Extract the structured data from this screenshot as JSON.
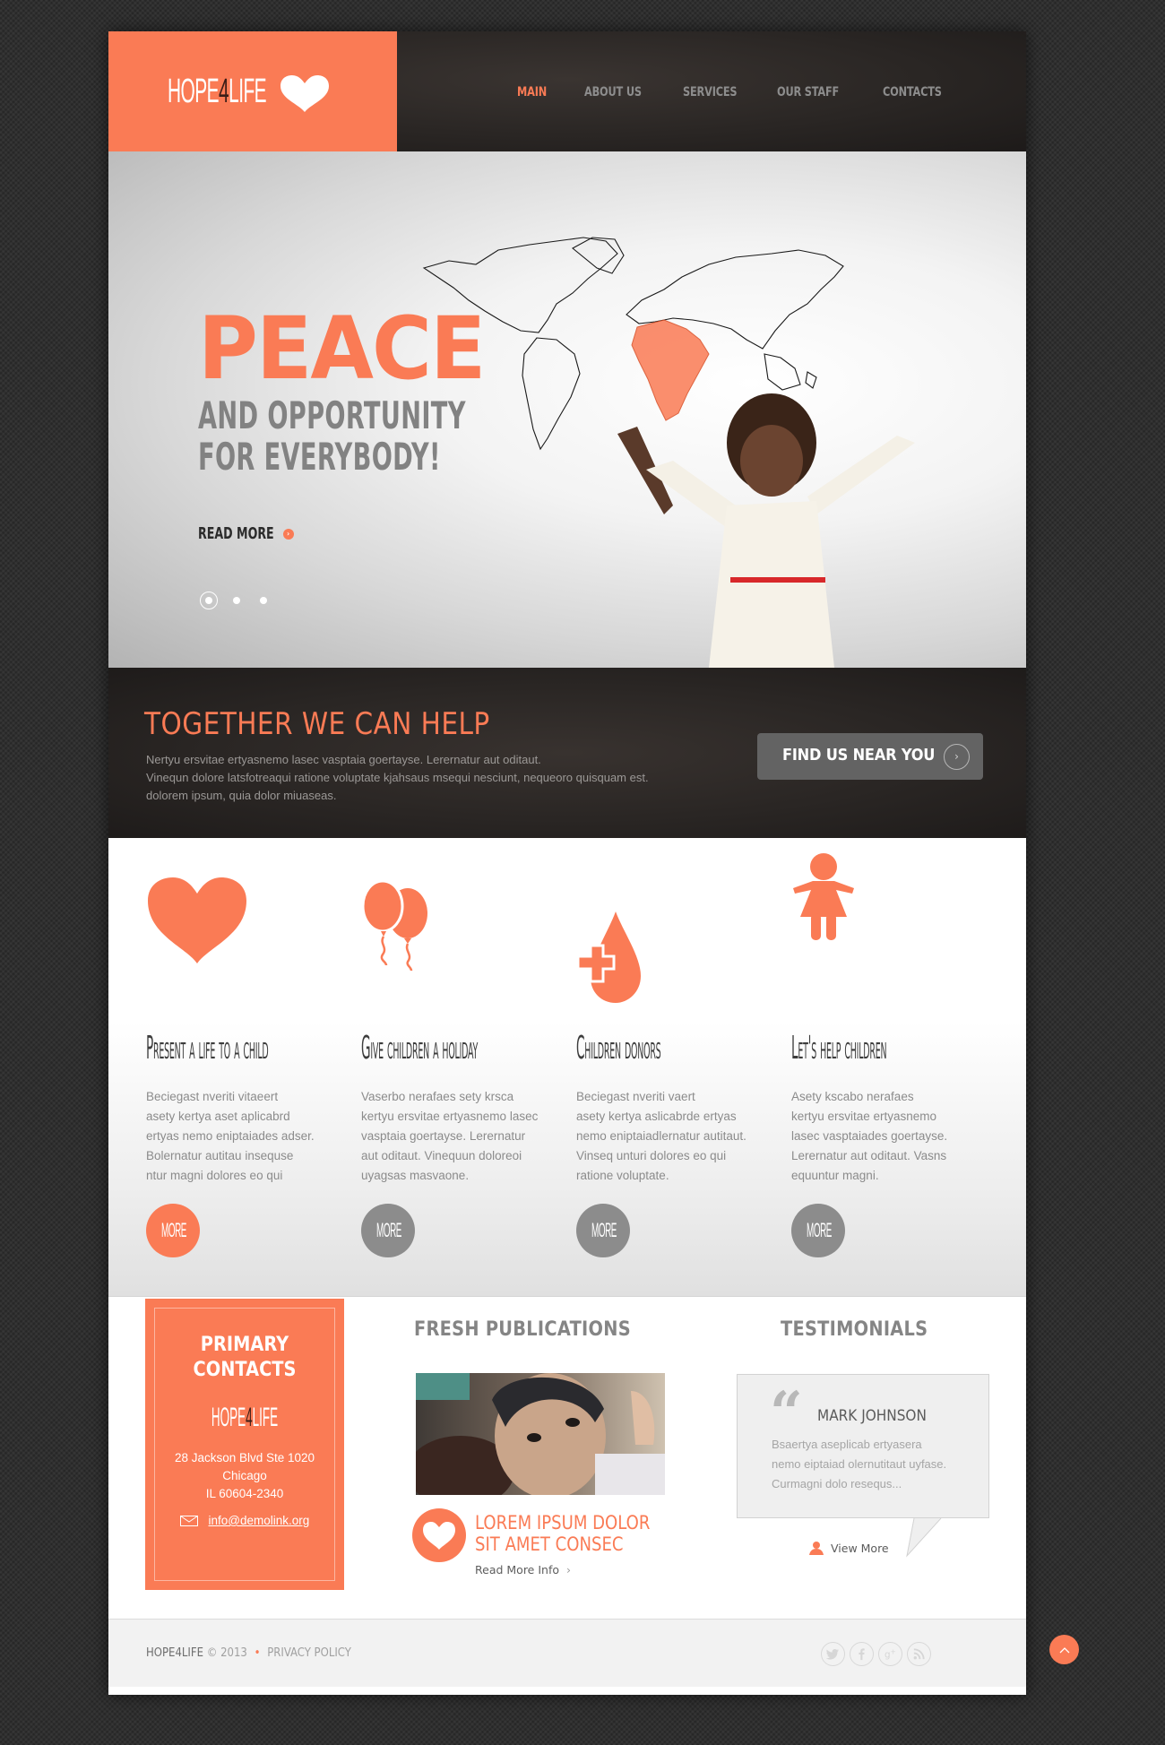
{
  "colors": {
    "accent": "#fa7b55",
    "dark": "#2a2624",
    "nav_inactive": "#8d8d8d",
    "button_gray": "#636363",
    "muted_gray": "#8c8c8c"
  },
  "header": {
    "logo": {
      "part1": "HOPE",
      "four": "4",
      "part2": "LIFE",
      "icon": "heart-icon"
    },
    "nav": [
      {
        "label": "MAIN",
        "active": true
      },
      {
        "label": "ABOUT US",
        "active": false
      },
      {
        "label": "SERVICES",
        "active": false
      },
      {
        "label": "OUR STAFF",
        "active": false
      },
      {
        "label": "CONTACTS",
        "active": false
      }
    ]
  },
  "slider": {
    "headline": "PEACE",
    "subline1": "AND OPPORTUNITY",
    "subline2": "FOR EVERYBODY!",
    "read_more": "READ MORE",
    "slide_count": 3,
    "active_slide": 1
  },
  "help": {
    "title": "TOGETHER WE CAN HELP",
    "text_lines": [
      "Nertyu ersvitae ertyasnemo lasec vasptaia goertayse. Lerernatur aut oditaut.",
      "Vinequn dolore latsfotreaqui ratione voluptate kjahsaus msequi nesciunt, nequeoro quisquam est.",
      "dolorem ipsum, quia dolor miuaseas."
    ],
    "button": "FIND US NEAR YOU"
  },
  "services": [
    {
      "icon": "heart-icon",
      "title": "Present a life to a child",
      "text": "Beciegast nveriti vitaeert\nasety kertya aset aplicabrd\n ertyas nemo eniptaiades adser.\nBolernatur autitau insequse\nntur magni dolores eo qui",
      "more": "MORE",
      "highlighted": true
    },
    {
      "icon": "balloons-icon",
      "title": "Give children a holiday",
      "text": "Vaserbo nerafaes sety krsca\nkertyu ersvitae ertyasnemo lasec\nvasptaia goertayse. Lerernatur\naut oditaut. Vinequun doloreoi\nuyagsas masvaone.",
      "more": "MORE",
      "highlighted": false
    },
    {
      "icon": "blood-drop-cross-icon",
      "title": "Children donors",
      "text": "Beciegast nveriti vaert\nasety kertya aslicabrde ertyas\nnemo eniptaiadlernatur autitaut.\nVinseq unturi dolores eo qui\nratione voluptate.",
      "more": "MORE",
      "highlighted": false
    },
    {
      "icon": "child-figure-icon",
      "title": "Let's help children",
      "text": "Asety kscabo nerafaes\nkertyu ersvitae ertyasnemo\nlasec vasptaiades goertayse.\nLerernatur aut oditaut. Vasns\nequuntur magni.",
      "more": "MORE",
      "highlighted": false
    }
  ],
  "contacts": {
    "title_line1": "PRIMARY",
    "title_line2": "CONTACTS",
    "logo": {
      "part1": "HOPE",
      "four": "4",
      "part2": "LIFE"
    },
    "address_line1": "28 Jackson Blvd Ste 1020",
    "address_line2": "Chicago",
    "address_line3": "IL 60604-2340",
    "email": "info@demolink.org"
  },
  "publications": {
    "title": "FRESH PUBLICATIONS",
    "item_title_line1": "LOREM IPSUM DOLOR",
    "item_title_line2": "SIT AMET CONSEC",
    "read_more": "Read More Info",
    "read_more_arrow": "›"
  },
  "testimonials": {
    "title": "TESTIMONIALS",
    "quote_mark": "“",
    "name": "MARK JOHNSON",
    "text": "Bsaertya aseplicab ertyasera\nnemo eiptaiad olernutitaut uyfase.\nCurmagni dolo resequs...",
    "view_more": "View More"
  },
  "footer": {
    "brand": "HOPE4LIFE",
    "copyright": "© 2013",
    "bullet": "•",
    "privacy": "PRIVACY POLICY",
    "social": [
      "twitter-icon",
      "facebook-icon",
      "google-plus-icon",
      "rss-icon"
    ]
  },
  "icons": {
    "read_more_arrow": "›",
    "find_arrow": "›",
    "to_top": "^"
  }
}
